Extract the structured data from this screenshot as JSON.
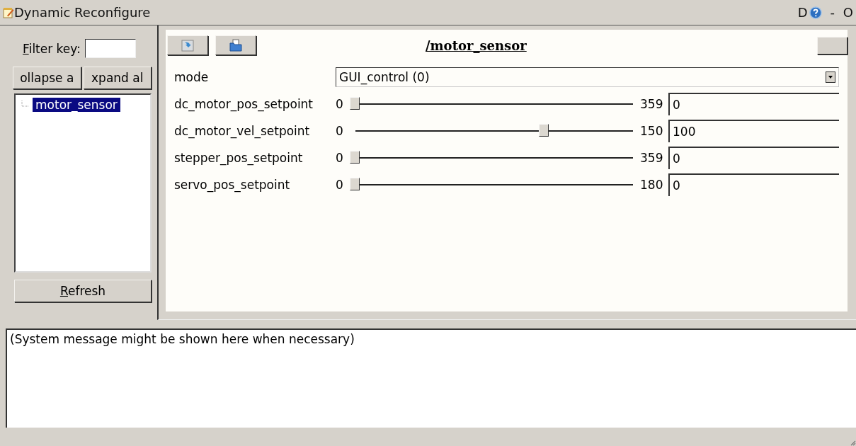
{
  "window": {
    "title": "Dynamic Reconfigure",
    "title_right": "D",
    "title_controls": "- O"
  },
  "sidebar": {
    "filter_label": "Filter key:",
    "buttons": [
      "ollapse a",
      "xpand al"
    ],
    "tree": [
      {
        "label": "motor_sensor",
        "selected": true
      }
    ],
    "refresh": "Refresh"
  },
  "panel": {
    "title": "/motor_sensor",
    "params": [
      {
        "kind": "enum",
        "name": "mode",
        "value": "GUI_control (0)"
      },
      {
        "kind": "slider",
        "name": "dc_motor_pos_setpoint",
        "min": "0",
        "max": "359",
        "level": 0,
        "value": "0"
      },
      {
        "kind": "slider",
        "name": "dc_motor_vel_setpoint",
        "min": "0",
        "max": "150",
        "level": 0.667,
        "value": "100"
      },
      {
        "kind": "slider",
        "name": "stepper_pos_setpoint",
        "min": "0",
        "max": "359",
        "level": 0,
        "value": "0"
      },
      {
        "kind": "slider",
        "name": "servo_pos_setpoint",
        "min": "0",
        "max": "180",
        "level": 0,
        "value": "0"
      }
    ]
  },
  "message": "(System message might be shown here when necessary)"
}
